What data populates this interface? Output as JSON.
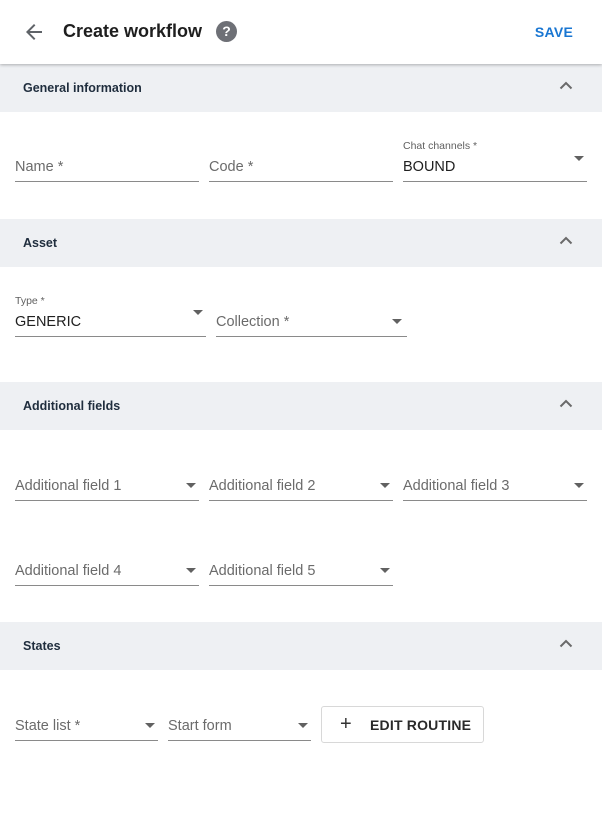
{
  "header": {
    "title": "Create workflow",
    "help_glyph": "?",
    "save_label": "SAVE",
    "back_icon": "arrow-left-icon",
    "accent_color": "#1976d2"
  },
  "sections": {
    "general": {
      "title": "General information",
      "fields": {
        "name": {
          "placeholder": "Name *"
        },
        "code": {
          "placeholder": "Code *"
        },
        "chat_channels": {
          "label": "Chat channels *",
          "value": "BOUND"
        }
      }
    },
    "asset": {
      "title": "Asset",
      "fields": {
        "type": {
          "label": "Type *",
          "value": "GENERIC"
        },
        "collection": {
          "placeholder": "Collection *"
        }
      }
    },
    "additional": {
      "title": "Additional fields",
      "fields": [
        "Additional field 1",
        "Additional field 2",
        "Additional field 3",
        "Additional field 4",
        "Additional field 5"
      ]
    },
    "states": {
      "title": "States",
      "fields": {
        "state_list": {
          "placeholder": "State list *"
        },
        "start_form": {
          "placeholder": "Start form"
        }
      },
      "edit_routine": {
        "icon": "+",
        "label": "EDIT ROUTINE"
      }
    }
  },
  "colors": {
    "section_background": "#eef0f3",
    "section_title": "#1f2d3d",
    "help_icon": "#6e7076"
  }
}
